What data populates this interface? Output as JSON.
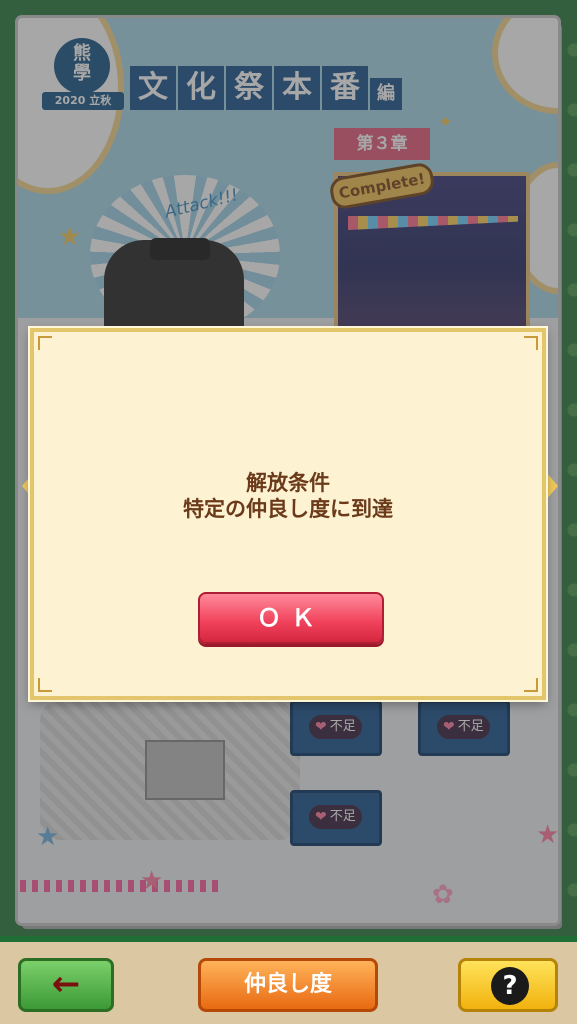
{
  "header": {
    "crest_mark": "熊\n學",
    "crest_year": "2020 立秋",
    "title_chars": [
      "文",
      "化",
      "祭",
      "本",
      "番"
    ],
    "title_suffix": "編"
  },
  "chapter": {
    "tag": "第３章",
    "complete_badge": "Complete!"
  },
  "art": {
    "attack_text": "Attack!!!"
  },
  "locked_slots": [
    {
      "label": "不足"
    },
    {
      "label": "不足"
    },
    {
      "label": "不足"
    }
  ],
  "modal": {
    "line1": "解放条件",
    "line2": "特定の仲良し度に到達",
    "ok_label": "ＯＫ"
  },
  "bottom_bar": {
    "back_label": "←",
    "friendship_label": "仲良し度",
    "help_label": "?"
  },
  "colors": {
    "frame_green": "#2e7d40",
    "modal_bg": "#fdf3d2",
    "ok_red": "#f0405a",
    "friendship_orange": "#e86a12",
    "help_yellow": "#f1b20e",
    "back_green": "#3c9a36"
  }
}
